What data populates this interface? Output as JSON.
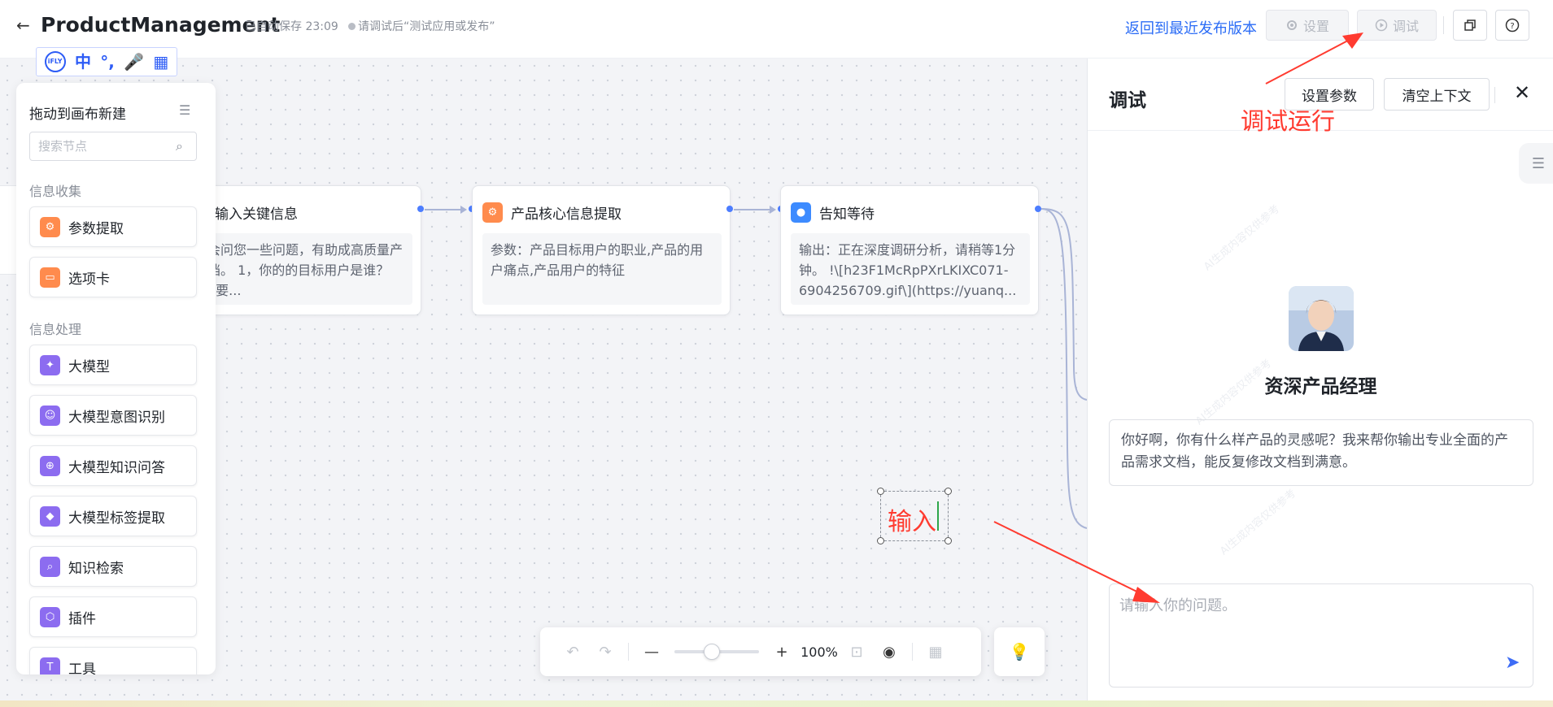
{
  "header": {
    "title": "ProductManagement",
    "autosave": "已自动保存 23:09",
    "hint": "请调试后“测试应用或发布”",
    "revert_label": "返回到最近发布版本",
    "settings_label": "设置",
    "debug_label": "调试"
  },
  "toolbar_icons": [
    "ifly-logo-icon",
    "chinese-input-icon",
    "punctuation-icon",
    "microphone-icon",
    "grid-apps-icon"
  ],
  "toolbar_text": {
    "ifly": "iFLY",
    "zh": "中"
  },
  "palette": {
    "title": "拖动到画布新建",
    "search_placeholder": "搜索节点",
    "section1": "信息收集",
    "section2": "信息处理",
    "items": [
      {
        "label": "参数提取",
        "icon": "parameter-extract-icon",
        "color": "orange"
      },
      {
        "label": "选项卡",
        "icon": "option-card-icon",
        "color": "orange"
      },
      {
        "label": "大模型",
        "icon": "llm-sparkle-icon",
        "color": "purple"
      },
      {
        "label": "大模型意图识别",
        "icon": "intent-robot-icon",
        "color": "purple"
      },
      {
        "label": "大模型知识问答",
        "icon": "knowledge-qa-icon",
        "color": "purple"
      },
      {
        "label": "大模型标签提取",
        "icon": "tag-icon",
        "color": "purple"
      },
      {
        "label": "知识检索",
        "icon": "search-knowledge-icon",
        "color": "purple"
      },
      {
        "label": "插件",
        "icon": "plugin-icon",
        "color": "purple"
      },
      {
        "label": "工具",
        "icon": "tool-icon",
        "color": "purple"
      }
    ]
  },
  "nodes": [
    {
      "title": "问用户输入关键信息",
      "body": "下面会问您一些问题，有助成高质量产品文档。 1，你的的目标用户是谁？  2，你要..."
    },
    {
      "title": "产品核心信息提取",
      "body": "参数：产品目标用户的职业,产品的用户痛点,产品用户的特征"
    },
    {
      "title": "告知等待",
      "body": "输出：正在深度调研分析，请稍等1分钟。  !\\[h23F1McRpPXrLKIXC071-6904256709.gif\\](https://yuanq..."
    }
  ],
  "annotations": {
    "input_text": "输入",
    "debug_run": "调试运行"
  },
  "zoom": {
    "percent": "100%",
    "level": 0.5
  },
  "debug_panel": {
    "title": "调试",
    "set_params": "设置参数",
    "clear_context": "清空上下文",
    "bot_name": "资深产品经理",
    "welcome": "你好啊，你有什么样产品的灵感呢？我来帮你输出专业全面的产品需求文档，能反复修改文档到满意。",
    "input_placeholder": "请输入你的问题。",
    "watermark": "AI生成内容仅供参考"
  },
  "colors": {
    "accent": "#2b6cf6",
    "annotation": "#ff3b30",
    "orange_icon": "#ff8b4d",
    "purple_icon": "#8c6cf0",
    "blue_icon": "#3d8bff"
  }
}
